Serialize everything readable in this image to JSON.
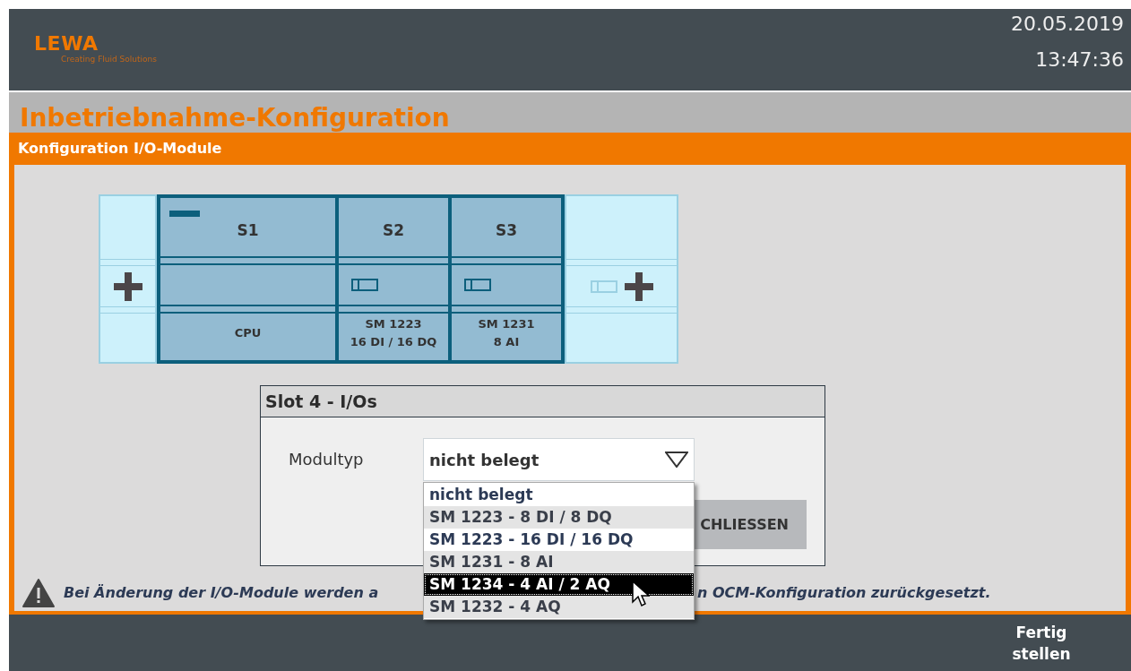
{
  "header": {
    "logo": "LEWA",
    "tagline": "Creating Fluid Solutions",
    "date": "20.05.2019",
    "time": "13:47:36"
  },
  "title": "Inbetriebnahme-Konfiguration",
  "section": "Konfiguration I/O-Module",
  "rack": [
    {
      "kind": "placeholder"
    },
    {
      "kind": "cpu",
      "slot": "S1",
      "lines": [
        "CPU"
      ]
    },
    {
      "kind": "module",
      "slot": "S2",
      "lines": [
        "SM 1223",
        "16 DI / 16 DQ"
      ]
    },
    {
      "kind": "module",
      "slot": "S3",
      "lines": [
        "SM 1231",
        "8 AI"
      ]
    },
    {
      "kind": "placeholder"
    }
  ],
  "dialog": {
    "title": "Slot 4 - I/Os",
    "field_label": "Modultyp",
    "value": "nicht belegt",
    "button": "CHLIESSEN",
    "options": [
      {
        "label": "nicht belegt",
        "highlighted": false
      },
      {
        "label": "SM 1223 - 8 DI / 8 DQ",
        "highlighted": false
      },
      {
        "label": "SM 1223 - 16 DI / 16 DQ",
        "highlighted": false
      },
      {
        "label": "SM 1231 - 8 AI",
        "highlighted": false
      },
      {
        "label": "SM 1234 - 4 AI / 2 AQ",
        "highlighted": true
      },
      {
        "label": "SM 1232 - 4 AQ",
        "highlighted": false
      }
    ]
  },
  "warning": [
    "Bei Änderung der I/O-Module werden a",
    "n OCM-Konfiguration zurückgesetzt."
  ],
  "footer_button": "Fertig stellen"
}
